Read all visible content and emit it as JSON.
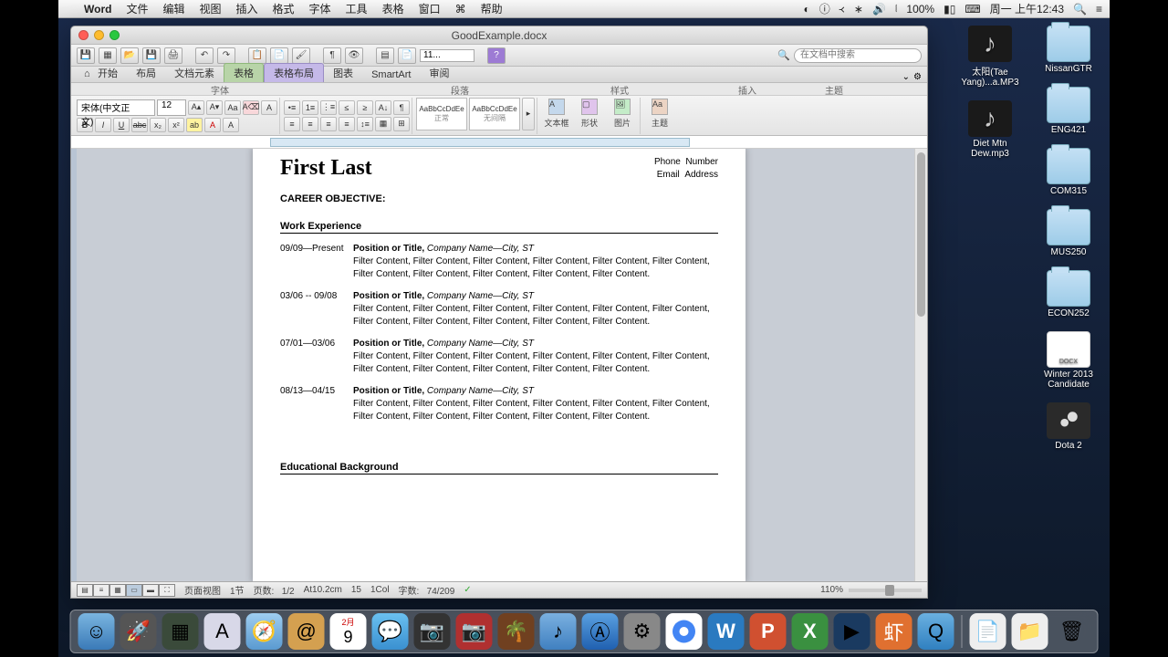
{
  "menubar": {
    "app": "Word",
    "items": [
      "文件",
      "编辑",
      "视图",
      "插入",
      "格式",
      "字体",
      "工具",
      "表格",
      "窗口",
      "帮助"
    ],
    "battery": "100%",
    "clock": "周一 上午12:43"
  },
  "window": {
    "title": "GoodExample.docx",
    "search_placeholder": "在文档中搜索",
    "zoom_toolbar": "11..."
  },
  "ribbon": {
    "tabs": [
      "开始",
      "布局",
      "文档元素",
      "表格",
      "表格布局",
      "图表",
      "SmartArt",
      "审阅"
    ],
    "groups": [
      "字体",
      "段落",
      "样式",
      "插入",
      "主题"
    ],
    "font_name": "宋体(中文正文)",
    "font_size": "12",
    "style1": "AaBbCcDdEe",
    "style1_label": "正常",
    "style2": "AaBbCcDdEe",
    "style2_label": "无间隔",
    "big_btns": [
      "文本框",
      "形状",
      "图片",
      "主题"
    ]
  },
  "document": {
    "name": "First Last",
    "phone_label": "Phone",
    "phone_val": "Number",
    "email_label": "Email",
    "email_val": "Address",
    "career_hdr": "CAREER OBJECTIVE:",
    "work_hdr": "Work Experience",
    "edu_hdr": "Educational Background",
    "jobs": [
      {
        "date": "09/09—Present",
        "title": "Position or Title,",
        "co": " Company Name—City, ST",
        "body": "Filter Content, Filter Content, Filter Content, Filter Content, Filter Content, Filter Content, Filter Content, Filter Content, Filter Content, Filter Content, Filter Content."
      },
      {
        "date": "03/06 -- 09/08",
        "title": "Position or Title,",
        "co": " Company Name—City, ST",
        "body": "Filter Content, Filter Content, Filter Content, Filter Content, Filter Content, Filter Content, Filter Content, Filter Content, Filter Content, Filter Content, Filter Content."
      },
      {
        "date": "07/01—03/06",
        "title": "Position or Title,",
        "co": " Company Name—City, ST",
        "body": "Filter Content, Filter Content, Filter Content, Filter Content, Filter Content, Filter Content, Filter Content, Filter Content, Filter Content, Filter Content, Filter Content."
      },
      {
        "date": "08/13—04/15",
        "title": "Position or Title,",
        "co": " Company Name—City, ST",
        "body": "Filter Content, Filter Content, Filter Content, Filter Content, Filter Content, Filter Content, Filter Content, Filter Content, Filter Content, Filter Content, Filter Content."
      }
    ]
  },
  "statusbar": {
    "view_label": "页面视图",
    "section": "1节",
    "pages_label": "页数:",
    "pages": "1/2",
    "at": "At10.2cm",
    "ln": "15",
    "col_label": "1Col",
    "words_label": "字数:",
    "words": "74/209",
    "zoom": "110%"
  },
  "desktop_icons": [
    {
      "type": "music",
      "label": "太阳(Tae Yang)...a.MP3"
    },
    {
      "type": "music",
      "label": "Diet Mtn Dew.mp3"
    },
    {
      "type": "folder",
      "label": "NissanGTR"
    },
    {
      "type": "folder",
      "label": "ENG421"
    },
    {
      "type": "folder",
      "label": "COM315"
    },
    {
      "type": "folder",
      "label": "MUS250"
    },
    {
      "type": "folder",
      "label": "ECON252"
    },
    {
      "type": "docfile",
      "label": "Winter 2013 Candidate"
    },
    {
      "type": "steam",
      "label": "Dota 2"
    }
  ]
}
